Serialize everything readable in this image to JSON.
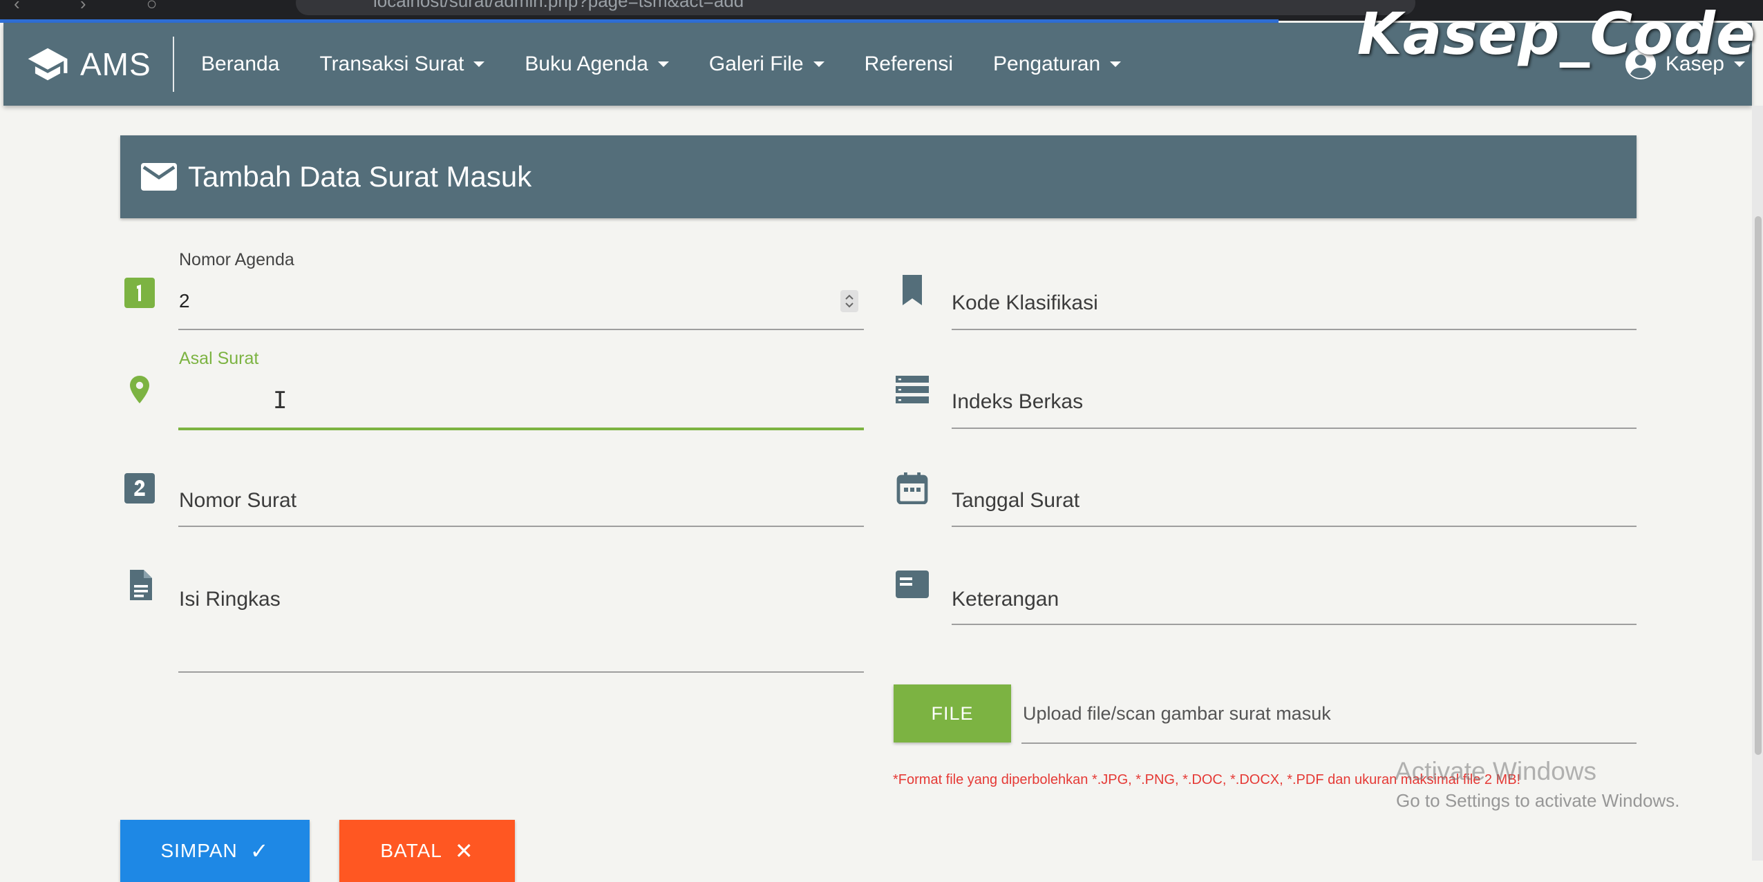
{
  "browser": {
    "url": "localhost/surat/admin.php?page=tsm&act=add"
  },
  "watermark": "Kasep_Code",
  "navbar": {
    "brand": "AMS",
    "brand_icon": "graduation-cap-icon",
    "menu": [
      {
        "label": "Beranda",
        "dropdown": false
      },
      {
        "label": "Transaksi Surat",
        "dropdown": true
      },
      {
        "label": "Buku Agenda",
        "dropdown": true
      },
      {
        "label": "Galeri File",
        "dropdown": true
      },
      {
        "label": "Referensi",
        "dropdown": false
      },
      {
        "label": "Pengaturan",
        "dropdown": true
      }
    ],
    "user": "Kasep"
  },
  "card": {
    "title": "Tambah Data Surat Masuk",
    "icon": "mail-icon"
  },
  "form": {
    "nomor_agenda": {
      "label": "Nomor Agenda",
      "value": "2",
      "icon": "looks-one-icon"
    },
    "asal_surat": {
      "label": "Asal Surat",
      "value": "",
      "icon": "place-icon",
      "focused": true
    },
    "nomor_surat": {
      "placeholder": "Nomor Surat",
      "icon": "looks-two-icon"
    },
    "isi_ringkas": {
      "placeholder": "Isi Ringkas",
      "icon": "description-icon"
    },
    "kode_klasifikasi": {
      "placeholder": "Kode Klasifikasi",
      "icon": "bookmark-icon"
    },
    "indeks_berkas": {
      "placeholder": "Indeks Berkas",
      "icon": "storage-icon"
    },
    "tanggal_surat": {
      "placeholder": "Tanggal Surat",
      "icon": "date-range-icon"
    },
    "keterangan": {
      "placeholder": "Keterangan",
      "icon": "featured-play-list-icon"
    },
    "file": {
      "button": "FILE",
      "placeholder": "Upload file/scan gambar surat masuk",
      "note": "*Format file yang diperbolehkan *.JPG, *.PNG, *.DOC, *.DOCX, *.PDF dan ukuran maksimal file 2 MB!"
    }
  },
  "buttons": {
    "save": "SIMPAN",
    "save_icon": "✓",
    "cancel": "BATAL",
    "cancel_icon": "✕"
  },
  "activate_windows": {
    "title": "Activate Windows",
    "subtitle": "Go to Settings to activate Windows."
  },
  "colors": {
    "navbar": "#546e7a",
    "accent_green": "#7cb342",
    "save_blue": "#1e88e5",
    "cancel_orange": "#ff5722",
    "note_red": "#e53935"
  }
}
